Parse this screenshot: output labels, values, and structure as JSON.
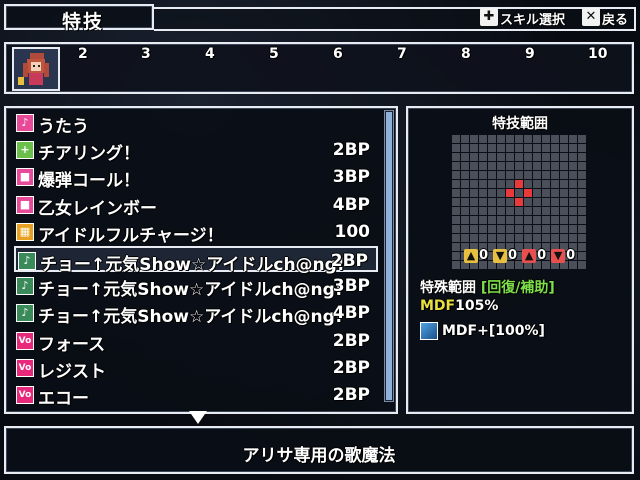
{
  "header": {
    "title": "特技",
    "skill_select_label": "スキル選択",
    "back_label": "戻る"
  },
  "tabs": {
    "numbers": [
      "2",
      "3",
      "4",
      "5",
      "6",
      "7",
      "8",
      "9",
      "10"
    ]
  },
  "skills": [
    {
      "name": "うたう",
      "cost": "",
      "icon": "music-note-icon",
      "icon_color": "#e84a9a"
    },
    {
      "name": "チアリング！",
      "cost": "2BP",
      "icon": "plus-icon",
      "icon_color": "#6ac04a"
    },
    {
      "name": "爆弾コール！",
      "cost": "3BP",
      "icon": "square-pink-icon",
      "icon_color": "#e84a9a"
    },
    {
      "name": "乙女レインボー",
      "cost": "4BP",
      "icon": "square-pink-icon",
      "icon_color": "#e84a9a"
    },
    {
      "name": "アイドルフルチャージ！",
      "cost": "100",
      "icon": "checker-icon",
      "icon_color": "#e8a020"
    },
    {
      "name": "チョー↑元気Show☆アイドルch@ng!",
      "cost": "2BP",
      "icon": "note-green-icon",
      "icon_color": "#3a8a5a"
    },
    {
      "name": "チョー↑元気Show☆アイドルch@ng!",
      "cost": "3BP",
      "icon": "note-plus-icon",
      "icon_color": "#3a8a5a"
    },
    {
      "name": "チョー↑元気Show☆アイドルch@ng!",
      "cost": "4BP",
      "icon": "note-plus2-icon",
      "icon_color": "#3a8a5a"
    },
    {
      "name": "フォース",
      "cost": "2BP",
      "icon": "vo-icon",
      "icon_color": "#e8287a"
    },
    {
      "name": "レジスト",
      "cost": "2BP",
      "icon": "vo-icon",
      "icon_color": "#e8287a"
    },
    {
      "name": "エコー",
      "cost": "2BP",
      "icon": "vo-icon",
      "icon_color": "#e8287a"
    }
  ],
  "selected_index": 5,
  "range_panel": {
    "title": "特技範囲",
    "indicators": [
      "0",
      "0",
      "0",
      "0"
    ],
    "special_range_label": "特殊範囲",
    "special_range_value": "[回復/補助]",
    "mdf_label": "MDF",
    "mdf_value": "105%",
    "mdf_plus": "MDF+[100%]"
  },
  "description": "アリサ専用の歌魔法",
  "colors": {
    "accent_green": "#7ee04a",
    "range_red": "#e83a3a",
    "grid_cell": "#4a4f5a"
  }
}
